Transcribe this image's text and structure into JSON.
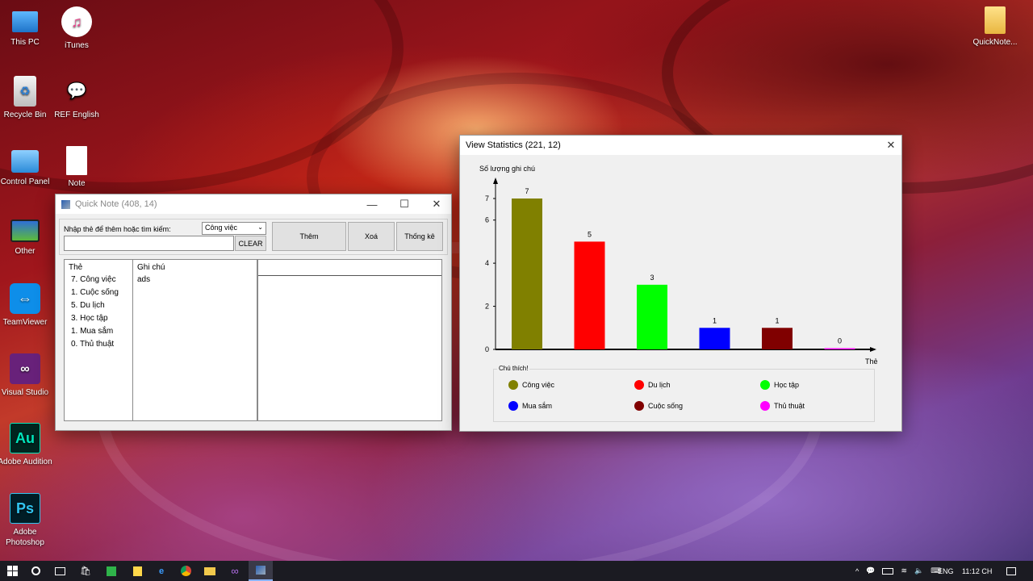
{
  "desktop": {
    "icons_left": [
      {
        "label": "This PC",
        "icon": "pc-icon"
      },
      {
        "label": "iTunes",
        "icon": "itunes-icon"
      },
      {
        "label": "Recycle Bin",
        "icon": "recycle-bin-icon"
      },
      {
        "label": "REF English",
        "icon": "ref-english-icon"
      },
      {
        "label": "Control Panel",
        "icon": "control-panel-icon"
      },
      {
        "label": "Note",
        "icon": "note-file-icon"
      },
      {
        "label": "Other",
        "icon": "monitor-icon"
      },
      {
        "label": "TeamViewer",
        "icon": "teamviewer-icon"
      },
      {
        "label": "Visual Studio",
        "icon": "visual-studio-icon"
      },
      {
        "label": "Adobe Audition",
        "icon": "adobe-audition-icon",
        "glyph": "Au"
      },
      {
        "label": "Adobe Photoshop",
        "icon": "adobe-photoshop-icon",
        "glyph": "Ps"
      }
    ],
    "icon_right": {
      "label": "QuickNote...",
      "icon": "folder-icon"
    }
  },
  "quicknote": {
    "title": "Quick Note (408, 14)",
    "search_label": "Nhập thẻ để thêm hoặc tìm kiếm:",
    "category_select": "Công việc",
    "search_value": "",
    "clear_label": "CLEAR",
    "add_label": "Thêm",
    "delete_label": "Xoá",
    "stats_label": "Thống kê",
    "tags_header": "Thẻ",
    "notes_header": "Ghi chú",
    "tags": [
      "7. Công việc",
      "1. Cuộc sống",
      "5. Du lịch",
      "3. Học tập",
      "1. Mua sắm",
      "0. Thủ thuật"
    ],
    "notes": [
      "ads"
    ],
    "detail_text": ""
  },
  "stats": {
    "title": "View Statistics (221, 12)",
    "legend_title": "Chú thích!"
  },
  "chart_data": {
    "type": "bar",
    "ylabel": "Số lượng ghi chú",
    "xlabel": "Thẻ",
    "yticks": [
      0,
      2,
      4,
      6,
      7
    ],
    "ylim": [
      0,
      7
    ],
    "categories": [
      "Công việc",
      "Du lịch",
      "Học tập",
      "Mua sắm",
      "Cuộc sống",
      "Thủ thuật"
    ],
    "values": [
      7,
      5,
      3,
      1,
      1,
      0
    ],
    "colors": [
      "#808000",
      "#ff0000",
      "#00ff00",
      "#0000ff",
      "#800000",
      "#ff00ff"
    ],
    "legend": [
      {
        "name": "Công việc",
        "color": "#808000"
      },
      {
        "name": "Du lịch",
        "color": "#ff0000"
      },
      {
        "name": "Học tập",
        "color": "#00ff00"
      },
      {
        "name": "Mua sắm",
        "color": "#0000ff"
      },
      {
        "name": "Cuộc sống",
        "color": "#800000"
      },
      {
        "name": "Thủ thuật",
        "color": "#ff00ff"
      }
    ]
  },
  "taskbar": {
    "language": "ENG",
    "time": "11:12 CH"
  }
}
